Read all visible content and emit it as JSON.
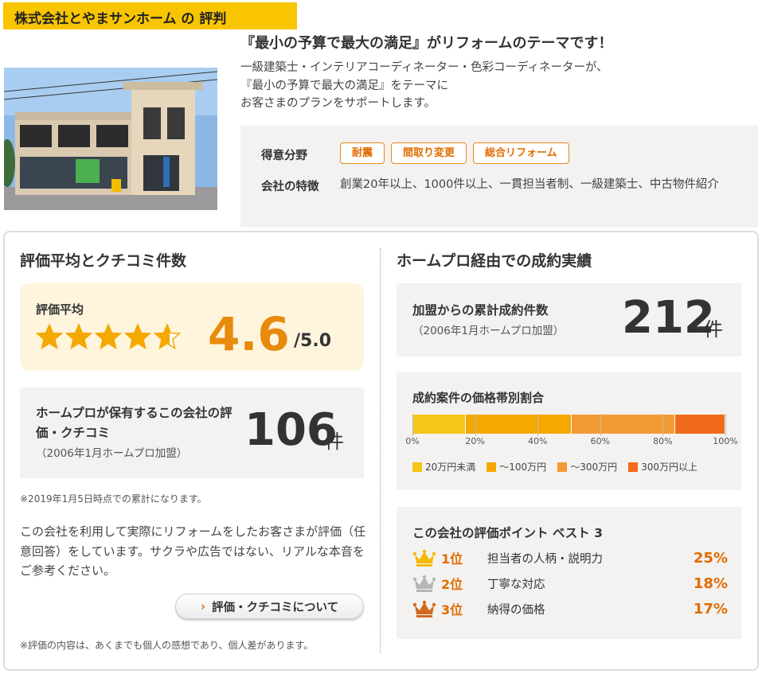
{
  "header": {
    "title": "株式会社とやまサンホーム の 評判",
    "lead": "『最小の予算で最大の満足』がリフォームのテーマです！",
    "description": [
      "一級建築士・インテリアコーディネーター・色彩コーディネーターが、",
      "『最小の予算で最大の満足』をテーマに",
      "お客さまのプランをサポートします。"
    ]
  },
  "features": {
    "specialty_label": "得意分野",
    "tags": [
      "耐震",
      "間取り変更",
      "総合リフォーム"
    ],
    "traits_label": "会社の特徴",
    "traits_text": "創業20年以上、1000件以上、一貫担当者制、一級建築士、中古物件紹介"
  },
  "left": {
    "heading": "評価平均とクチコミ件数",
    "rating_label": "評価平均",
    "rating_value": "4.6",
    "rating_max": "/5.0",
    "rating_stars": 4.6,
    "count_label": "ホームプロが保有するこの会社の評価・クチコミ",
    "count_sub": "（2006年1月ホームプロ加盟）",
    "count_value": "106",
    "count_unit": "件",
    "note1": "※2019年1月5日時点での累計になります。",
    "body": "この会社を利用して実際にリフォームをしたお客さまが評価（任意回答）をしています。サクラや広告ではない、リアルな本音をご参考ください。",
    "about_button": "評価・クチコミについて",
    "note2": "※評価の内容は、あくまでも個人の感想であり、個人差があります。"
  },
  "right": {
    "heading": "ホームプロ経由での成約実績",
    "contract_label": "加盟からの累計成約件数",
    "contract_sub": "（2006年1月ホームプロ加盟）",
    "contract_value": "212",
    "contract_unit": "件",
    "price_title": "成約案件の価格帯別割合",
    "best_title": "この会社の評価ポイント ベスト 3",
    "ranks": [
      {
        "rank": "1位",
        "label": "担当者の人柄・説明力",
        "pct": "25%",
        "color": "#f5b90a"
      },
      {
        "rank": "2位",
        "label": "丁寧な対応",
        "pct": "18%",
        "color": "#b5b5b5"
      },
      {
        "rank": "3位",
        "label": "納得の価格",
        "pct": "17%",
        "color": "#d2691e"
      }
    ]
  },
  "chart_data": {
    "type": "bar",
    "orientation": "horizontal-stacked",
    "title": "成約案件の価格帯別割合",
    "series": [
      {
        "name": "20万円未満",
        "values": [
          17
        ],
        "color": "#f5c518"
      },
      {
        "name": "～100万円",
        "values": [
          34
        ],
        "color": "#f5a800"
      },
      {
        "name": "～300万円",
        "values": [
          33
        ],
        "color": "#f39a33"
      },
      {
        "name": "300万円以上",
        "values": [
          16
        ],
        "color": "#f26a1b"
      }
    ],
    "xlim": [
      0,
      100
    ],
    "tick_labels": [
      "0%",
      "20%",
      "40%",
      "60%",
      "80%",
      "100%"
    ],
    "legend": "bottom"
  }
}
